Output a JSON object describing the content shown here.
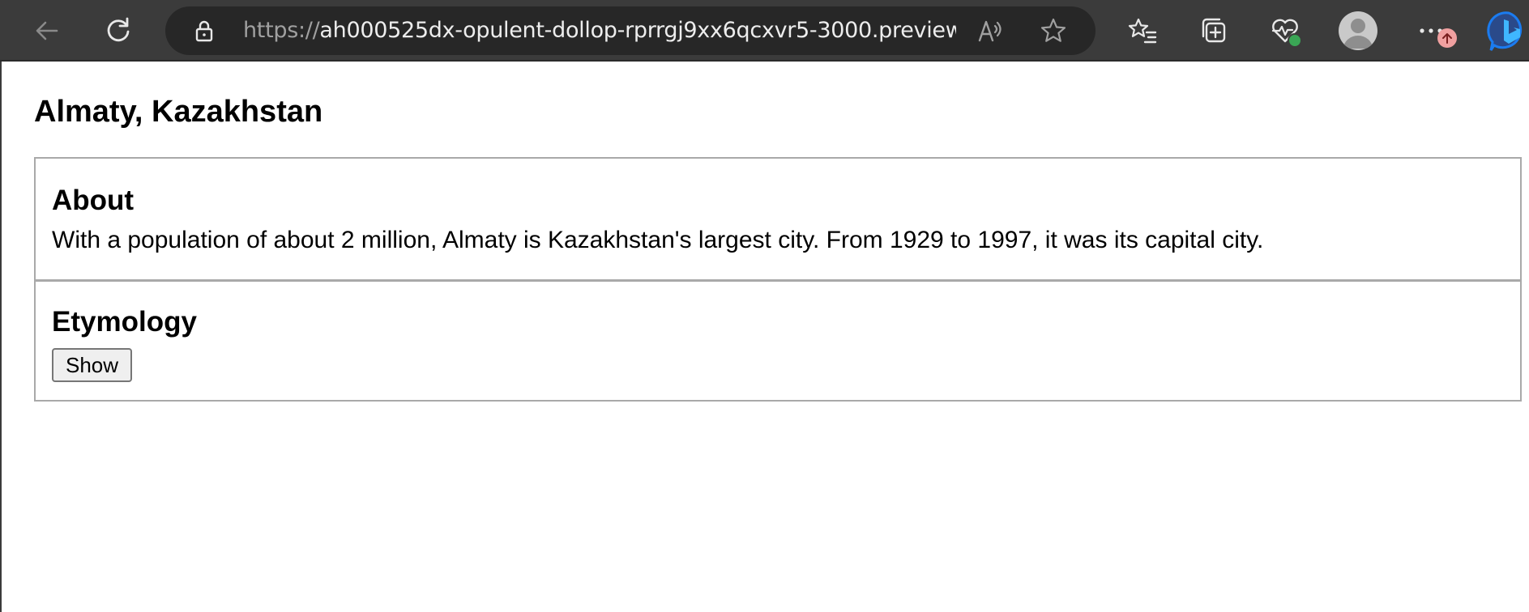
{
  "browser": {
    "url_scheme": "https://",
    "url_host": "ah000525dx-opulent-dollop-rprrgj9xx6qcxvr5-3000.preview.a...",
    "icons": {
      "back": "back-arrow-icon",
      "refresh": "refresh-icon",
      "lock": "lock-icon",
      "read_aloud": "read-aloud-icon",
      "favorite": "star-icon",
      "favorites_list": "favorites-icon",
      "collections": "collections-icon",
      "health": "browser-essentials-icon",
      "profile": "profile-avatar-icon",
      "more": "more-icon",
      "update": "update-arrow-icon",
      "copilot": "bing-copilot-icon"
    },
    "colors": {
      "toolbar_bg": "#3b3b3b",
      "address_bg": "#272727",
      "status_green": "#3aa655",
      "update_pink": "#f0a0a0",
      "copilot_blue": "#1b7cf0"
    }
  },
  "page": {
    "title": "Almaty, Kazakhstan",
    "about": {
      "heading": "About",
      "text": "With a population of about 2 million, Almaty is Kazakhstan's largest city. From 1929 to 1997, it was its capital city."
    },
    "etymology": {
      "heading": "Etymology",
      "button_label": "Show"
    }
  }
}
